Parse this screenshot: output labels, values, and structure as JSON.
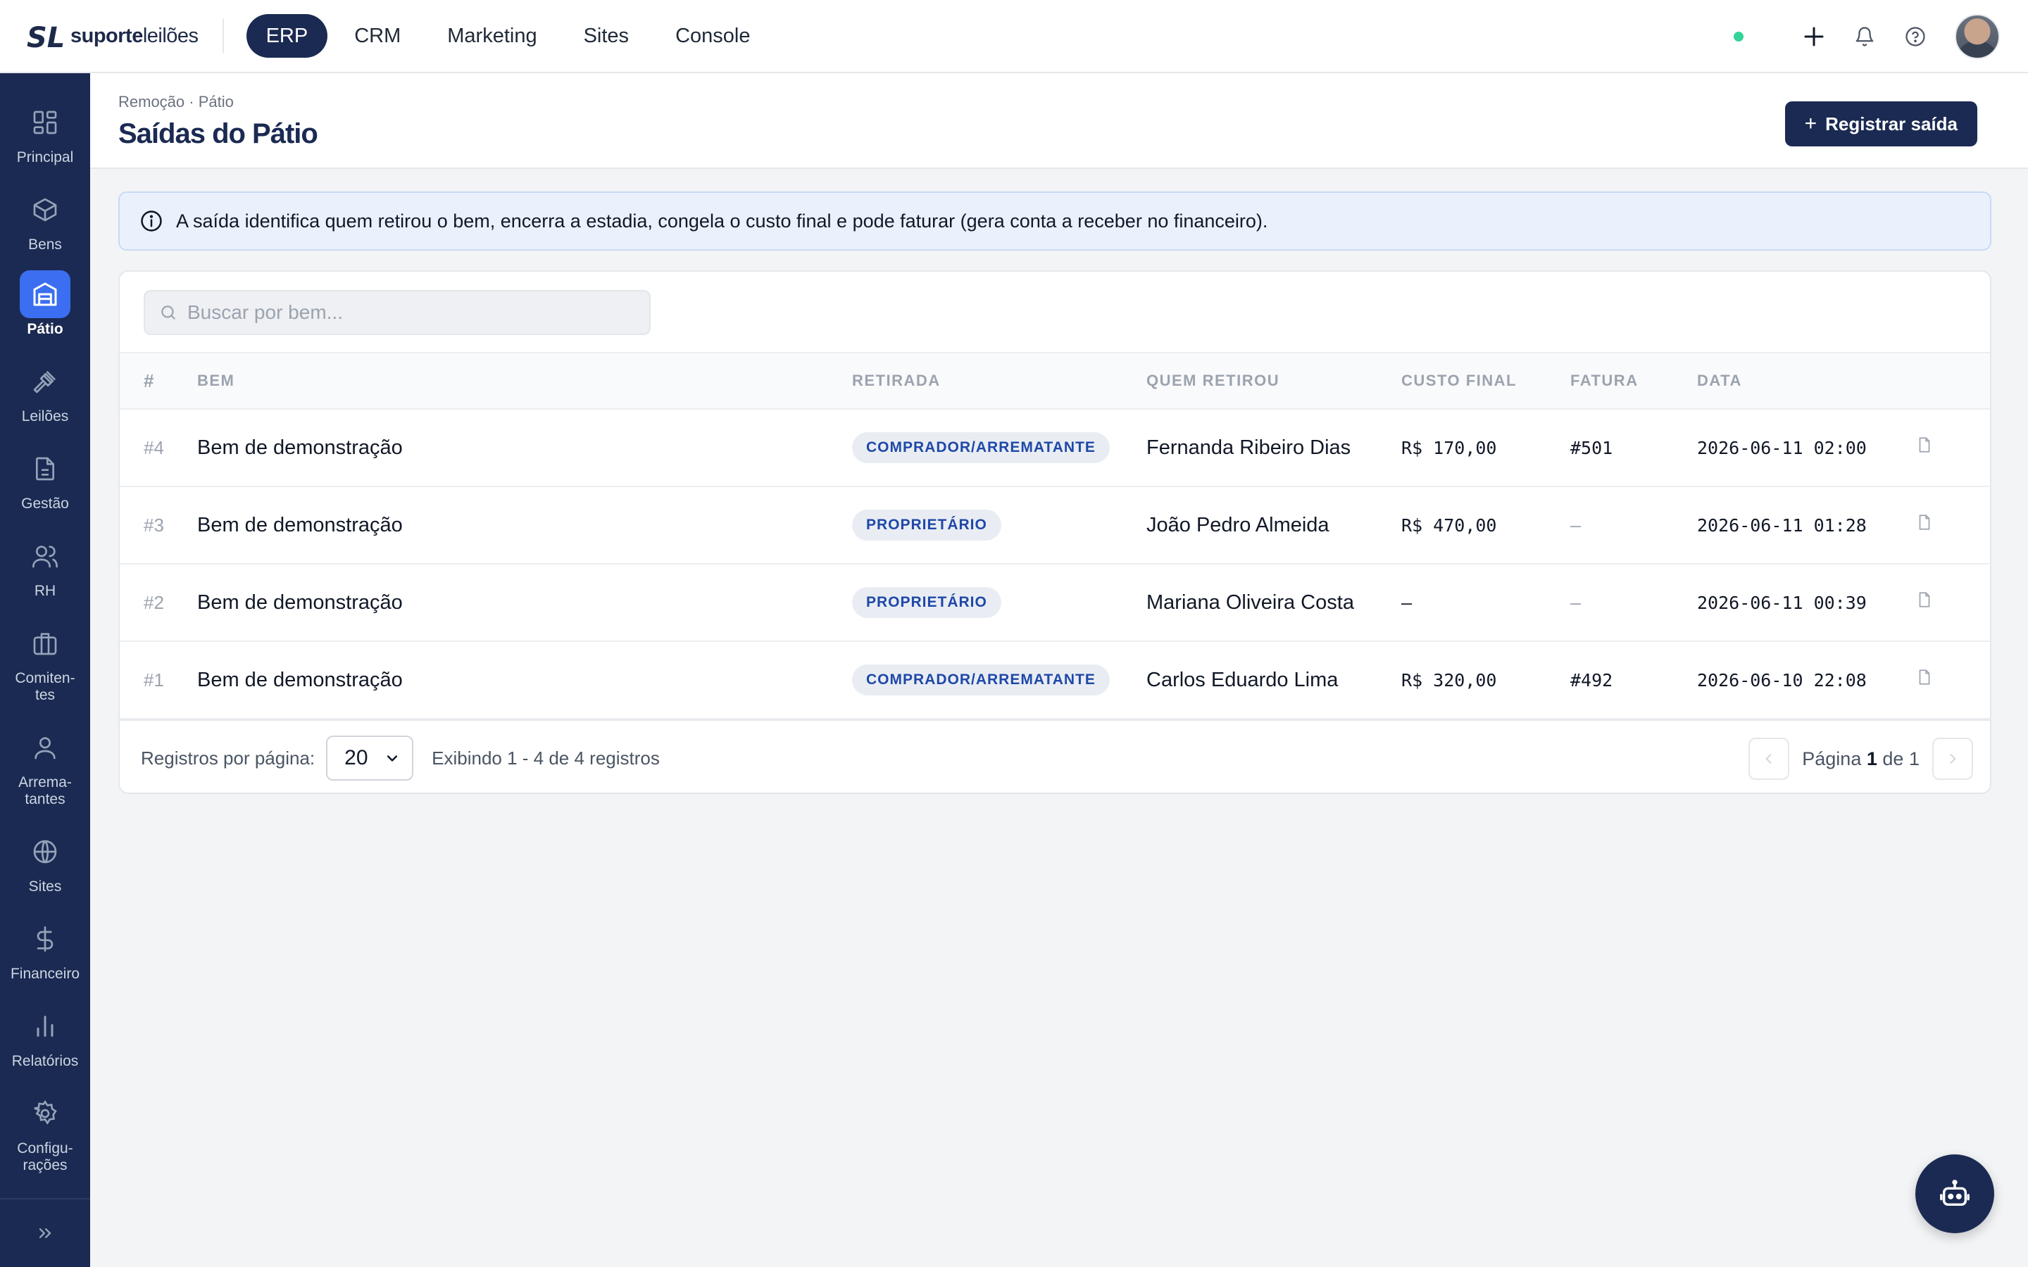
{
  "brand": {
    "name_bold": "suporte",
    "name_light": "leilões",
    "mark": "SL"
  },
  "top_nav": [
    {
      "label": "ERP",
      "active": true
    },
    {
      "label": "CRM",
      "active": false
    },
    {
      "label": "Marketing",
      "active": false
    },
    {
      "label": "Sites",
      "active": false
    },
    {
      "label": "Console",
      "active": false
    }
  ],
  "sidebar": [
    {
      "label": "Principal",
      "icon": "grid-icon",
      "active": false
    },
    {
      "label": "Bens",
      "icon": "box-icon",
      "active": false
    },
    {
      "label": "Pátio",
      "icon": "warehouse-icon",
      "active": true
    },
    {
      "label": "Leilões",
      "icon": "gavel-icon",
      "active": false
    },
    {
      "label": "Gestão",
      "icon": "document-icon",
      "active": false
    },
    {
      "label": "RH",
      "icon": "users-icon",
      "active": false
    },
    {
      "label": "Comiten-\ntes",
      "icon": "briefcase-icon",
      "active": false
    },
    {
      "label": "Arrema-\ntantes",
      "icon": "user-icon",
      "active": false
    },
    {
      "label": "Sites",
      "icon": "globe-icon",
      "active": false
    },
    {
      "label": "Financeiro",
      "icon": "dollar-icon",
      "active": false
    },
    {
      "label": "Relatórios",
      "icon": "bar-chart-icon",
      "active": false
    },
    {
      "label": "Configu-\nrações",
      "icon": "gear-icon",
      "active": false
    }
  ],
  "header": {
    "breadcrumb": "Remoção · Pátio",
    "title": "Saídas do Pátio",
    "action_label": "Registrar saída"
  },
  "info_banner": "A saída identifica quem retirou o bem, encerra a estadia, congela o custo final e pode faturar (gera conta a receber no financeiro).",
  "search": {
    "placeholder": "Buscar por bem..."
  },
  "table": {
    "columns": [
      "#",
      "BEM",
      "RETIRADA",
      "QUEM RETIROU",
      "CUSTO FINAL",
      "FATURA",
      "DATA"
    ],
    "rows": [
      {
        "id": "#4",
        "bem": "Bem de demonstração",
        "retirada": "COMPRADOR/ARREMATANTE",
        "quem": "Fernanda Ribeiro Dias",
        "custo": "R$ 170,00",
        "fatura": "#501",
        "data": "2026-06-11 02:00"
      },
      {
        "id": "#3",
        "bem": "Bem de demonstração",
        "retirada": "PROPRIETÁRIO",
        "quem": "João Pedro Almeida",
        "custo": "R$ 470,00",
        "fatura": "—",
        "data": "2026-06-11 01:28"
      },
      {
        "id": "#2",
        "bem": "Bem de demonstração",
        "retirada": "PROPRIETÁRIO",
        "quem": "Mariana Oliveira Costa",
        "custo": "–",
        "fatura": "—",
        "data": "2026-06-11 00:39"
      },
      {
        "id": "#1",
        "bem": "Bem de demonstração",
        "retirada": "COMPRADOR/ARREMATANTE",
        "quem": "Carlos Eduardo Lima",
        "custo": "R$ 320,00",
        "fatura": "#492",
        "data": "2026-06-10 22:08"
      }
    ]
  },
  "pagination": {
    "per_page_label": "Registros por página:",
    "per_page_value": "20",
    "showing": "Exibindo 1 - 4 de 4 registros",
    "page_prefix": "Página",
    "page_current": "1",
    "page_of": "de",
    "page_total": "1"
  },
  "colors": {
    "navy": "#1b2a52",
    "accent": "#3b6ef0",
    "status_online": "#34d399",
    "badge_text": "#1f48a8"
  }
}
